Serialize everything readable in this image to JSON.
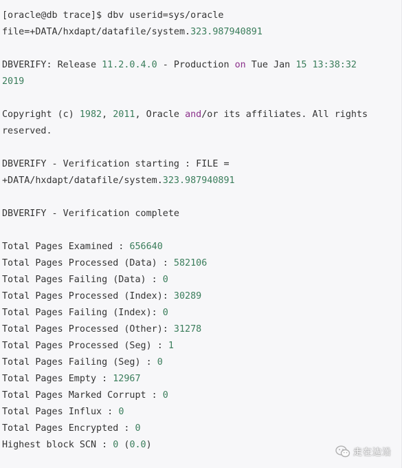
{
  "terminal": {
    "lines": [
      [
        {
          "t": "[oracle@db trace]$ dbv userid=sys/oracle",
          "c": "plain"
        }
      ],
      [
        {
          "t": "file=+DATA/hxdapt/datafile/system.",
          "c": "plain"
        },
        {
          "t": "323.987940891",
          "c": "num"
        }
      ],
      [],
      [
        {
          "t": "DBVERIFY: Release ",
          "c": "plain"
        },
        {
          "t": "11.2.0.4.0",
          "c": "num"
        },
        {
          "t": " - Production ",
          "c": "plain"
        },
        {
          "t": "on",
          "c": "kw"
        },
        {
          "t": " Tue Jan ",
          "c": "plain"
        },
        {
          "t": "15",
          "c": "num"
        },
        {
          "t": " ",
          "c": "plain"
        },
        {
          "t": "13:38:32",
          "c": "num"
        }
      ],
      [
        {
          "t": "2019",
          "c": "num"
        }
      ],
      [],
      [
        {
          "t": "Copyright (c) ",
          "c": "plain"
        },
        {
          "t": "1982",
          "c": "num"
        },
        {
          "t": ", ",
          "c": "plain"
        },
        {
          "t": "2011",
          "c": "num"
        },
        {
          "t": ", Oracle ",
          "c": "plain"
        },
        {
          "t": "and",
          "c": "kw"
        },
        {
          "t": "/or its affiliates. All rights",
          "c": "plain"
        }
      ],
      [
        {
          "t": "reserved.",
          "c": "plain"
        }
      ],
      [],
      [
        {
          "t": "DBVERIFY - Verification starting : FILE =",
          "c": "plain"
        }
      ],
      [
        {
          "t": "+DATA/hxdapt/datafile/system.",
          "c": "plain"
        },
        {
          "t": "323.987940891",
          "c": "num"
        }
      ],
      [],
      [
        {
          "t": "DBVERIFY - Verification complete",
          "c": "plain"
        }
      ],
      [],
      [
        {
          "t": "Total Pages Examined : ",
          "c": "plain"
        },
        {
          "t": "656640",
          "c": "num"
        }
      ],
      [
        {
          "t": "Total Pages Processed (Data) : ",
          "c": "plain"
        },
        {
          "t": "582106",
          "c": "num"
        }
      ],
      [
        {
          "t": "Total Pages Failing (Data) : ",
          "c": "plain"
        },
        {
          "t": "0",
          "c": "num"
        }
      ],
      [
        {
          "t": "Total Pages Processed (Index): ",
          "c": "plain"
        },
        {
          "t": "30289",
          "c": "num"
        }
      ],
      [
        {
          "t": "Total Pages Failing (Index): ",
          "c": "plain"
        },
        {
          "t": "0",
          "c": "num"
        }
      ],
      [
        {
          "t": "Total Pages Processed (Other): ",
          "c": "plain"
        },
        {
          "t": "31278",
          "c": "num"
        }
      ],
      [
        {
          "t": "Total Pages Processed (Seg) : ",
          "c": "plain"
        },
        {
          "t": "1",
          "c": "num"
        }
      ],
      [
        {
          "t": "Total Pages Failing (Seg) : ",
          "c": "plain"
        },
        {
          "t": "0",
          "c": "num"
        }
      ],
      [
        {
          "t": "Total Pages Empty : ",
          "c": "plain"
        },
        {
          "t": "12967",
          "c": "num"
        }
      ],
      [
        {
          "t": "Total Pages Marked Corrupt : ",
          "c": "plain"
        },
        {
          "t": "0",
          "c": "num"
        }
      ],
      [
        {
          "t": "Total Pages Influx : ",
          "c": "plain"
        },
        {
          "t": "0",
          "c": "num"
        }
      ],
      [
        {
          "t": "Total Pages Encrypted : ",
          "c": "plain"
        },
        {
          "t": "0",
          "c": "num"
        }
      ],
      [
        {
          "t": "Highest block SCN : ",
          "c": "plain"
        },
        {
          "t": "0",
          "c": "num"
        },
        {
          "t": " (",
          "c": "plain"
        },
        {
          "t": "0.0",
          "c": "num"
        },
        {
          "t": ")",
          "c": "plain"
        }
      ]
    ]
  },
  "watermark": {
    "icon": "wechat-icon",
    "text": "走在边沿"
  },
  "colors": {
    "background": "#f7f7f9",
    "text": "#333333",
    "number": "#3a7d5b",
    "keyword": "#8a2f8a"
  }
}
